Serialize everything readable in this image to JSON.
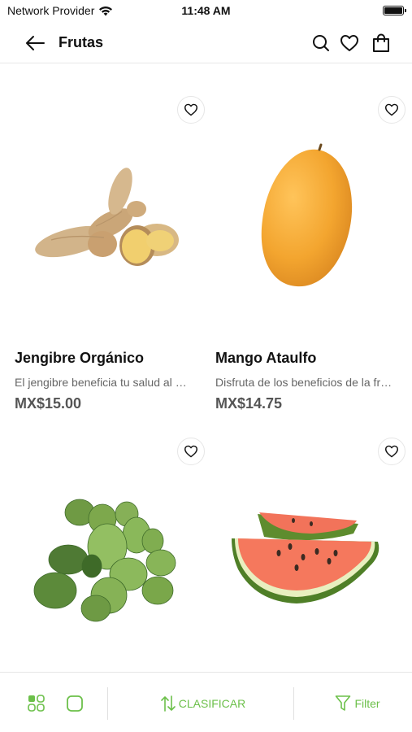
{
  "status_bar": {
    "carrier": "Network Provider",
    "time": "11:48 AM"
  },
  "header": {
    "title": "Frutas",
    "icons": [
      "back-arrow-icon",
      "search-icon",
      "heart-icon",
      "shopping-bag-icon"
    ]
  },
  "products": [
    {
      "name": "Jengibre Orgánico",
      "description": "El jengibre beneficia tu salud al mejorar",
      "price": "MX$15.00",
      "image": "ginger"
    },
    {
      "name": "Mango Ataulfo",
      "description": "Disfruta de los beneficios de la fruta",
      "price": "MX$14.75",
      "image": "mango"
    },
    {
      "name": "",
      "description": "",
      "price": "",
      "image": "grapes"
    },
    {
      "name": "",
      "description": "",
      "price": "",
      "image": "watermelon"
    }
  ],
  "toolbar": {
    "sort_label": "CLASIFICAR",
    "filter_label": "Filter",
    "accent_color": "#6cc04a"
  }
}
